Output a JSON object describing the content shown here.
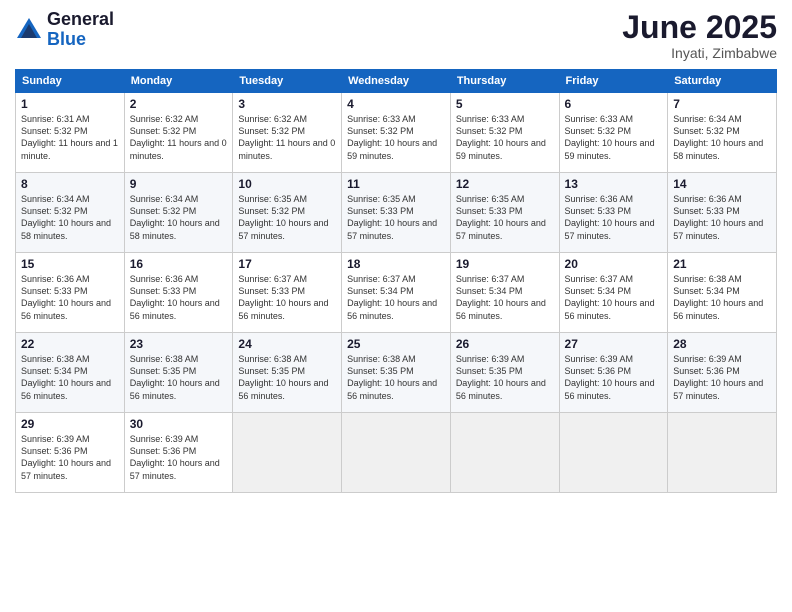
{
  "logo": {
    "general": "General",
    "blue": "Blue"
  },
  "title": {
    "month_year": "June 2025",
    "location": "Inyati, Zimbabwe"
  },
  "days_of_week": [
    "Sunday",
    "Monday",
    "Tuesday",
    "Wednesday",
    "Thursday",
    "Friday",
    "Saturday"
  ],
  "weeks": [
    [
      {
        "day": "1",
        "sunrise": "6:31 AM",
        "sunset": "5:32 PM",
        "daylight": "11 hours and 1 minute."
      },
      {
        "day": "2",
        "sunrise": "6:32 AM",
        "sunset": "5:32 PM",
        "daylight": "11 hours and 0 minutes."
      },
      {
        "day": "3",
        "sunrise": "6:32 AM",
        "sunset": "5:32 PM",
        "daylight": "11 hours and 0 minutes."
      },
      {
        "day": "4",
        "sunrise": "6:33 AM",
        "sunset": "5:32 PM",
        "daylight": "10 hours and 59 minutes."
      },
      {
        "day": "5",
        "sunrise": "6:33 AM",
        "sunset": "5:32 PM",
        "daylight": "10 hours and 59 minutes."
      },
      {
        "day": "6",
        "sunrise": "6:33 AM",
        "sunset": "5:32 PM",
        "daylight": "10 hours and 59 minutes."
      },
      {
        "day": "7",
        "sunrise": "6:34 AM",
        "sunset": "5:32 PM",
        "daylight": "10 hours and 58 minutes."
      }
    ],
    [
      {
        "day": "8",
        "sunrise": "6:34 AM",
        "sunset": "5:32 PM",
        "daylight": "10 hours and 58 minutes."
      },
      {
        "day": "9",
        "sunrise": "6:34 AM",
        "sunset": "5:32 PM",
        "daylight": "10 hours and 58 minutes."
      },
      {
        "day": "10",
        "sunrise": "6:35 AM",
        "sunset": "5:32 PM",
        "daylight": "10 hours and 57 minutes."
      },
      {
        "day": "11",
        "sunrise": "6:35 AM",
        "sunset": "5:33 PM",
        "daylight": "10 hours and 57 minutes."
      },
      {
        "day": "12",
        "sunrise": "6:35 AM",
        "sunset": "5:33 PM",
        "daylight": "10 hours and 57 minutes."
      },
      {
        "day": "13",
        "sunrise": "6:36 AM",
        "sunset": "5:33 PM",
        "daylight": "10 hours and 57 minutes."
      },
      {
        "day": "14",
        "sunrise": "6:36 AM",
        "sunset": "5:33 PM",
        "daylight": "10 hours and 57 minutes."
      }
    ],
    [
      {
        "day": "15",
        "sunrise": "6:36 AM",
        "sunset": "5:33 PM",
        "daylight": "10 hours and 56 minutes."
      },
      {
        "day": "16",
        "sunrise": "6:36 AM",
        "sunset": "5:33 PM",
        "daylight": "10 hours and 56 minutes."
      },
      {
        "day": "17",
        "sunrise": "6:37 AM",
        "sunset": "5:33 PM",
        "daylight": "10 hours and 56 minutes."
      },
      {
        "day": "18",
        "sunrise": "6:37 AM",
        "sunset": "5:34 PM",
        "daylight": "10 hours and 56 minutes."
      },
      {
        "day": "19",
        "sunrise": "6:37 AM",
        "sunset": "5:34 PM",
        "daylight": "10 hours and 56 minutes."
      },
      {
        "day": "20",
        "sunrise": "6:37 AM",
        "sunset": "5:34 PM",
        "daylight": "10 hours and 56 minutes."
      },
      {
        "day": "21",
        "sunrise": "6:38 AM",
        "sunset": "5:34 PM",
        "daylight": "10 hours and 56 minutes."
      }
    ],
    [
      {
        "day": "22",
        "sunrise": "6:38 AM",
        "sunset": "5:34 PM",
        "daylight": "10 hours and 56 minutes."
      },
      {
        "day": "23",
        "sunrise": "6:38 AM",
        "sunset": "5:35 PM",
        "daylight": "10 hours and 56 minutes."
      },
      {
        "day": "24",
        "sunrise": "6:38 AM",
        "sunset": "5:35 PM",
        "daylight": "10 hours and 56 minutes."
      },
      {
        "day": "25",
        "sunrise": "6:38 AM",
        "sunset": "5:35 PM",
        "daylight": "10 hours and 56 minutes."
      },
      {
        "day": "26",
        "sunrise": "6:39 AM",
        "sunset": "5:35 PM",
        "daylight": "10 hours and 56 minutes."
      },
      {
        "day": "27",
        "sunrise": "6:39 AM",
        "sunset": "5:36 PM",
        "daylight": "10 hours and 56 minutes."
      },
      {
        "day": "28",
        "sunrise": "6:39 AM",
        "sunset": "5:36 PM",
        "daylight": "10 hours and 57 minutes."
      }
    ],
    [
      {
        "day": "29",
        "sunrise": "6:39 AM",
        "sunset": "5:36 PM",
        "daylight": "10 hours and 57 minutes."
      },
      {
        "day": "30",
        "sunrise": "6:39 AM",
        "sunset": "5:36 PM",
        "daylight": "10 hours and 57 minutes."
      },
      null,
      null,
      null,
      null,
      null
    ]
  ]
}
